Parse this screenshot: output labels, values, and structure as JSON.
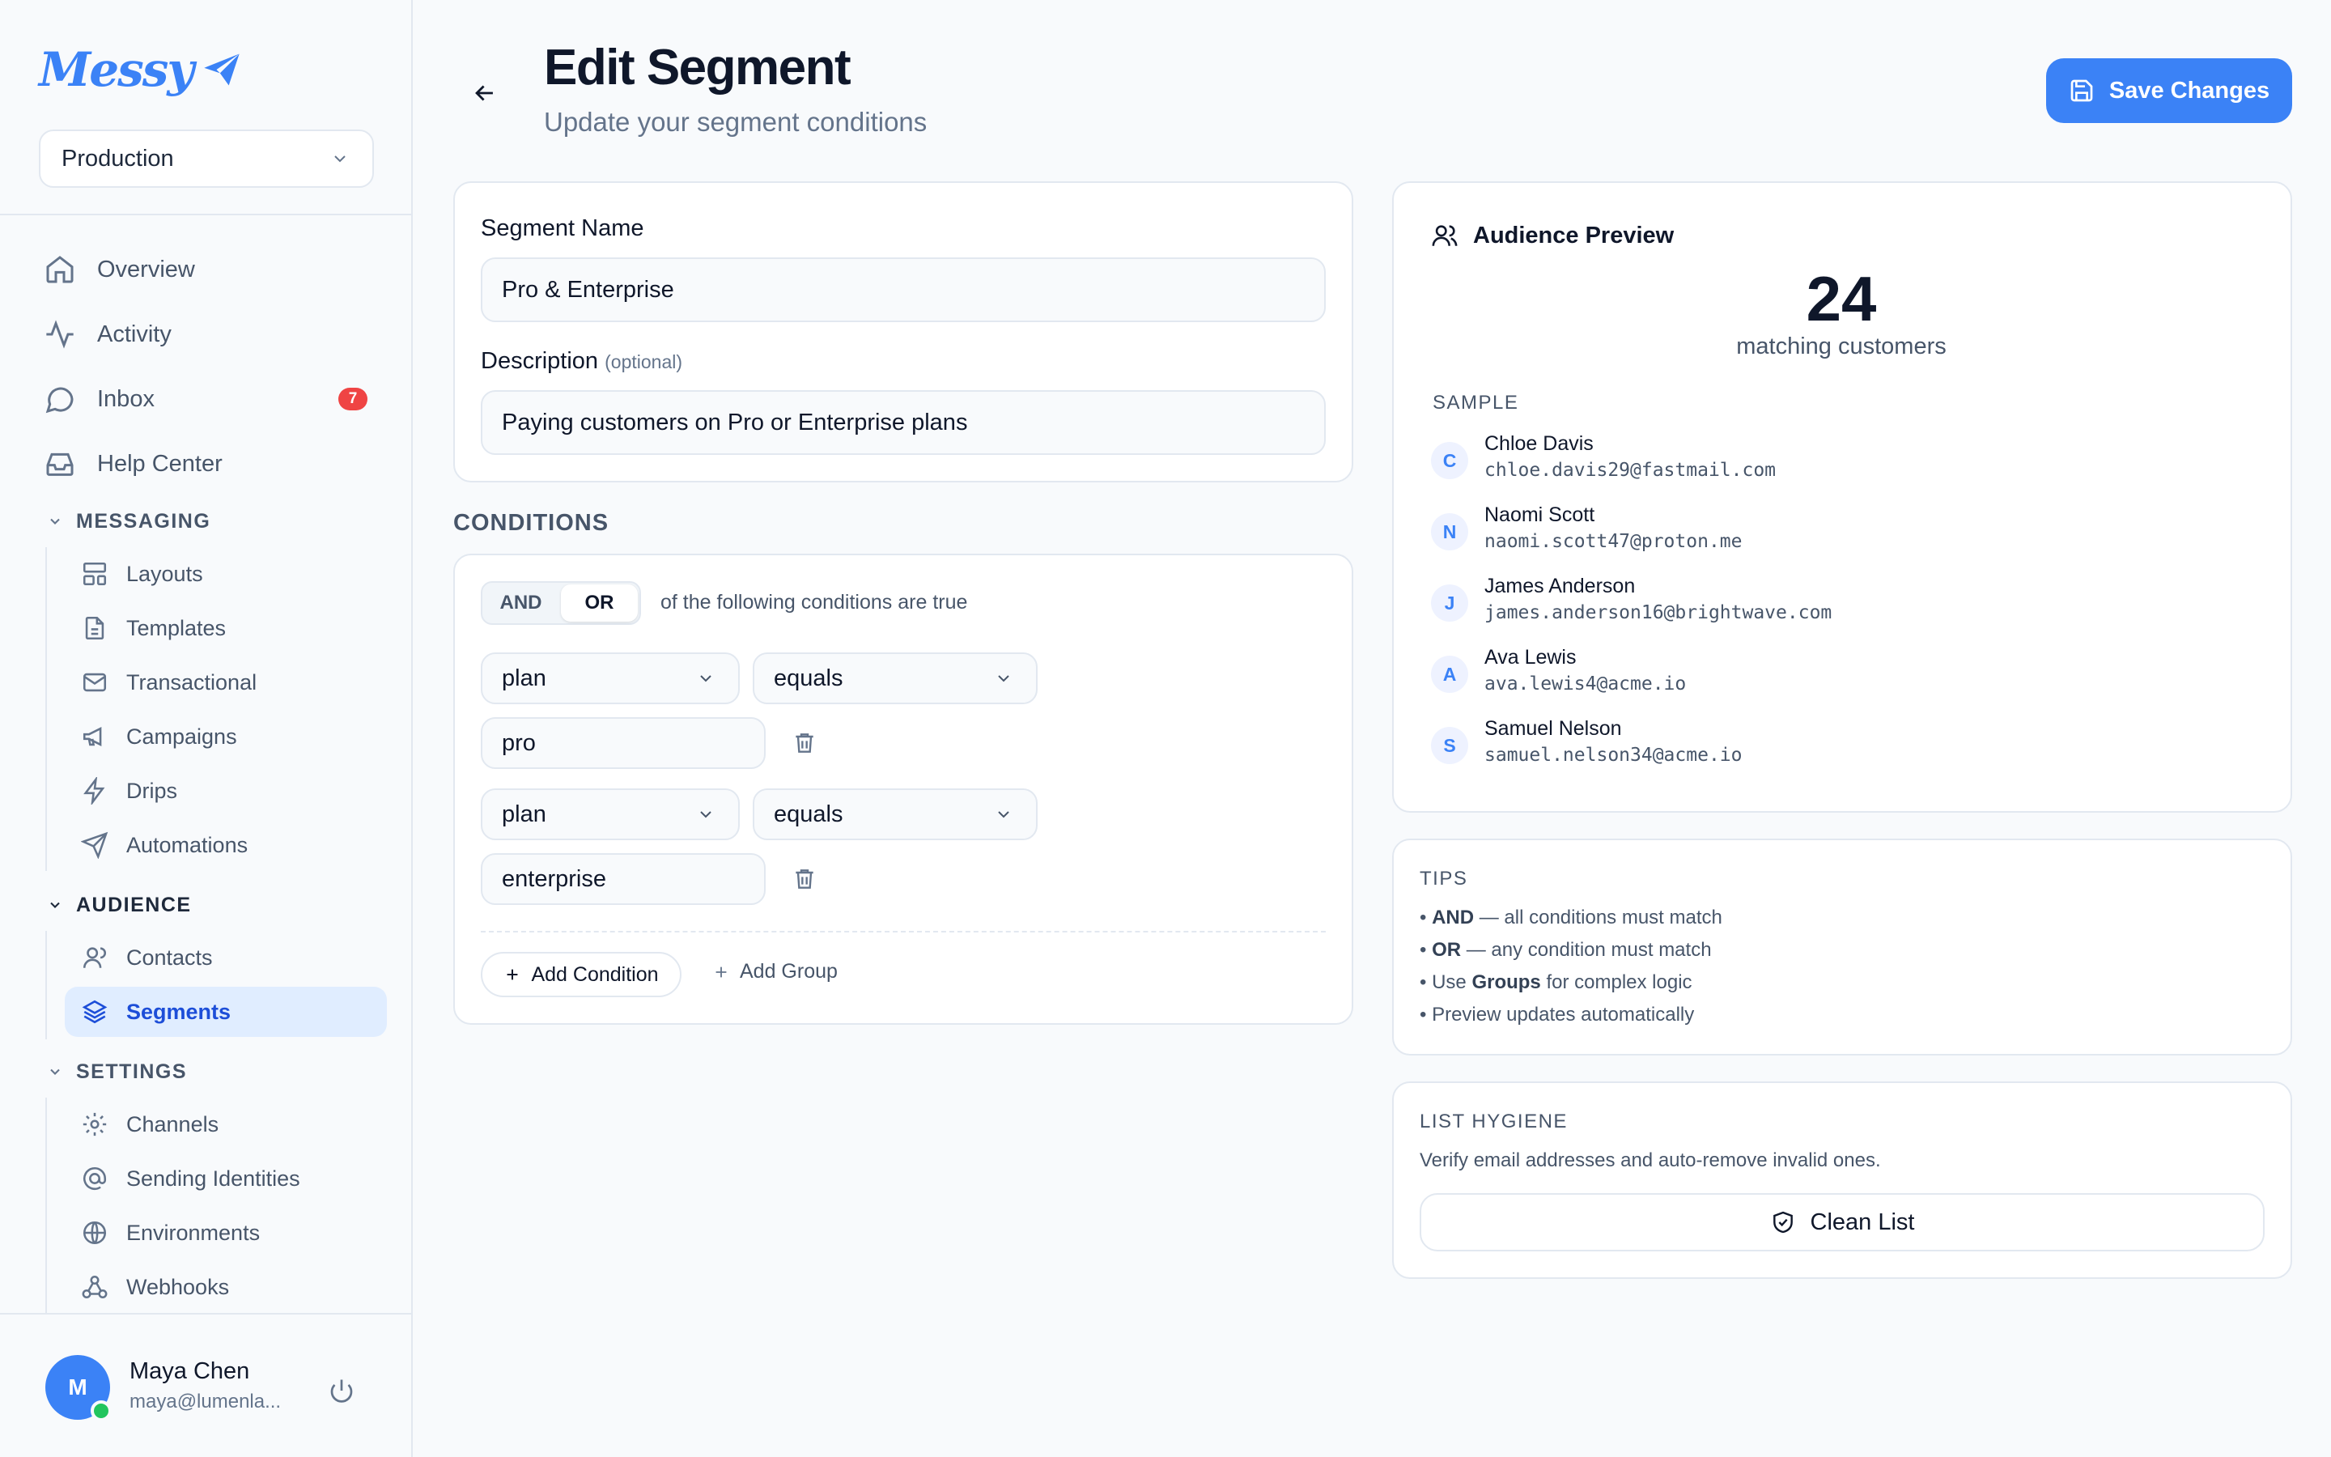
{
  "app": {
    "logo_text": "Messy"
  },
  "sidebar": {
    "environment": "Production",
    "nav": [
      {
        "label": "Overview",
        "icon": "home-icon"
      },
      {
        "label": "Activity",
        "icon": "activity-icon"
      },
      {
        "label": "Inbox",
        "icon": "chat-icon",
        "badge": "7"
      },
      {
        "label": "Help Center",
        "icon": "inbox-tray-icon"
      }
    ],
    "sections": [
      {
        "title": "MESSAGING",
        "items": [
          "Layouts",
          "Templates",
          "Transactional",
          "Campaigns",
          "Drips",
          "Automations"
        ]
      },
      {
        "title": "AUDIENCE",
        "items": [
          "Contacts",
          "Segments"
        ],
        "active_item": "Segments"
      },
      {
        "title": "SETTINGS",
        "items": [
          "Channels",
          "Sending Identities",
          "Environments",
          "Webhooks"
        ]
      }
    ],
    "user": {
      "initial": "M",
      "name": "Maya Chen",
      "email": "maya@lumenla..."
    }
  },
  "header": {
    "title": "Edit Segment",
    "subtitle": "Update your segment conditions",
    "save_label": "Save Changes"
  },
  "form": {
    "name_label": "Segment Name",
    "name_value": "Pro & Enterprise",
    "description_label": "Description",
    "description_optional": "(optional)",
    "description_value": "Paying customers on Pro or Enterprise plans"
  },
  "conditions": {
    "heading": "CONDITIONS",
    "logic_options": [
      "AND",
      "OR"
    ],
    "logic_selected": "OR",
    "logic_note": "of the following conditions are true",
    "rows": [
      {
        "field": "plan",
        "operator": "equals",
        "value": "pro"
      },
      {
        "field": "plan",
        "operator": "equals",
        "value": "enterprise"
      }
    ],
    "add_condition_label": "Add Condition",
    "add_group_label": "Add Group"
  },
  "preview": {
    "title": "Audience Preview",
    "count": "24",
    "count_label": "matching customers",
    "sample_label": "SAMPLE",
    "sample": [
      {
        "initial": "C",
        "name": "Chloe Davis",
        "email": "chloe.davis29@fastmail.com"
      },
      {
        "initial": "N",
        "name": "Naomi Scott",
        "email": "naomi.scott47@proton.me"
      },
      {
        "initial": "J",
        "name": "James Anderson",
        "email": "james.anderson16@brightwave.com"
      },
      {
        "initial": "A",
        "name": "Ava Lewis",
        "email": "ava.lewis4@acme.io"
      },
      {
        "initial": "S",
        "name": "Samuel Nelson",
        "email": "samuel.nelson34@acme.io"
      }
    ]
  },
  "tips": {
    "label": "TIPS",
    "items": [
      {
        "bold": "AND",
        "text": " — all conditions must match"
      },
      {
        "bold": "OR",
        "text": " — any condition must match"
      },
      {
        "pre": "Use ",
        "bold": "Groups",
        "text": " for complex logic"
      },
      {
        "text": "Preview updates automatically"
      }
    ]
  },
  "hygiene": {
    "label": "LIST HYGIENE",
    "description": "Verify email addresses and auto-remove invalid ones.",
    "button_label": "Clean List"
  },
  "colors": {
    "accent": "#3b82f6",
    "badge": "#ef4444",
    "online": "#22c55e",
    "active_bg": "#e0edff"
  }
}
